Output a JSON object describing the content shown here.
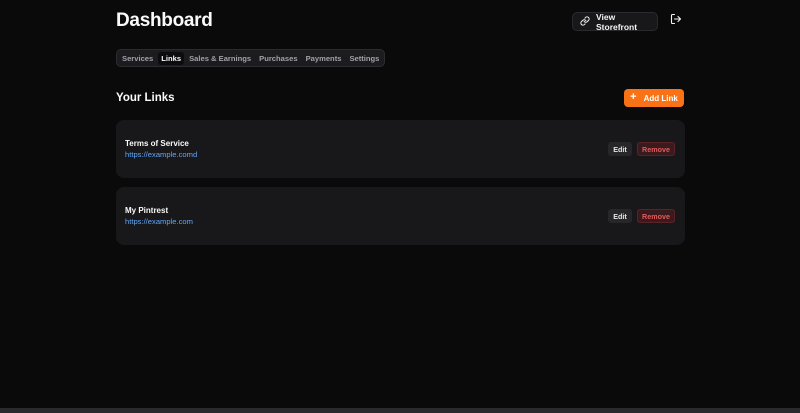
{
  "header": {
    "title": "Dashboard",
    "view_storefront_label": "View Storefront",
    "storefront_icon": "link-icon",
    "logout_icon": "logout-icon"
  },
  "tabs": [
    {
      "label": "Services",
      "active": false
    },
    {
      "label": "Links",
      "active": true
    },
    {
      "label": "Sales & Earnings",
      "active": false
    },
    {
      "label": "Purchases",
      "active": false
    },
    {
      "label": "Payments",
      "active": false
    },
    {
      "label": "Settings",
      "active": false
    }
  ],
  "links_section": {
    "title": "Your Links",
    "add_label": "Add Link",
    "add_icon": "plus-icon"
  },
  "links": [
    {
      "name": "Terms of Service",
      "url": "https://example.comd",
      "edit_label": "Edit",
      "remove_label": "Remove"
    },
    {
      "name": "My Pintrest",
      "url": "https://example.com",
      "edit_label": "Edit",
      "remove_label": "Remove"
    }
  ],
  "colors": {
    "background": "#0a0a0b",
    "card": "#18181b",
    "accent": "#f97316",
    "link": "#60a5fa",
    "danger": "#e05b5b"
  }
}
